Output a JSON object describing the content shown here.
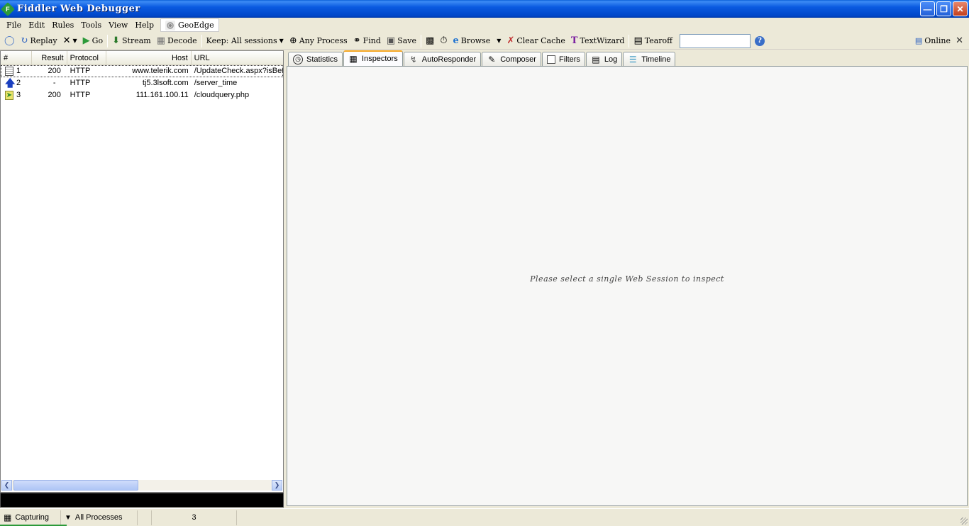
{
  "window": {
    "title": "Fiddler Web Debugger",
    "controls": [
      "minimize",
      "restore",
      "close"
    ]
  },
  "menu": {
    "items": [
      "File",
      "Edit",
      "Rules",
      "Tools",
      "View",
      "Help"
    ],
    "geoedge": "GeoEdge"
  },
  "toolbar": {
    "replay": "Replay",
    "go": "Go",
    "stream": "Stream",
    "decode": "Decode",
    "keep": "Keep: All sessions",
    "process": "Any Process",
    "find": "Find",
    "save": "Save",
    "browse": "Browse",
    "clear_cache": "Clear Cache",
    "textwizard": "TextWizard",
    "tearoff": "Tearoff",
    "search_value": "",
    "online": "Online"
  },
  "sessions": {
    "columns": [
      "#",
      "Result",
      "Protocol",
      "Host",
      "URL"
    ],
    "rows": [
      {
        "num": "1",
        "result": "200",
        "protocol": "HTTP",
        "host": "www.telerik.com",
        "url": "/UpdateCheck.aspx?isBet",
        "icon": "document-icon"
      },
      {
        "num": "2",
        "result": "-",
        "protocol": "HTTP",
        "host": "tj5.3lsoft.com",
        "url": "/server_time",
        "icon": "upload-arrow-icon"
      },
      {
        "num": "3",
        "result": "200",
        "protocol": "HTTP",
        "host": "111.161.100.11",
        "url": "/cloudquery.php",
        "icon": "response-arrow-icon"
      }
    ]
  },
  "tabs": [
    {
      "label": "Statistics",
      "icon": "stopwatch-icon"
    },
    {
      "label": "Inspectors",
      "icon": "inspectors-icon",
      "active": true
    },
    {
      "label": "AutoResponder",
      "icon": "lightning-icon"
    },
    {
      "label": "Composer",
      "icon": "pencil-icon"
    },
    {
      "label": "Filters",
      "icon": "checkbox-icon"
    },
    {
      "label": "Log",
      "icon": "log-icon"
    },
    {
      "label": "Timeline",
      "icon": "timeline-icon"
    }
  ],
  "content": {
    "hint": "Please select a single Web Session to inspect"
  },
  "status": {
    "capturing": "Capturing",
    "processes": "All Processes",
    "count": "3"
  }
}
